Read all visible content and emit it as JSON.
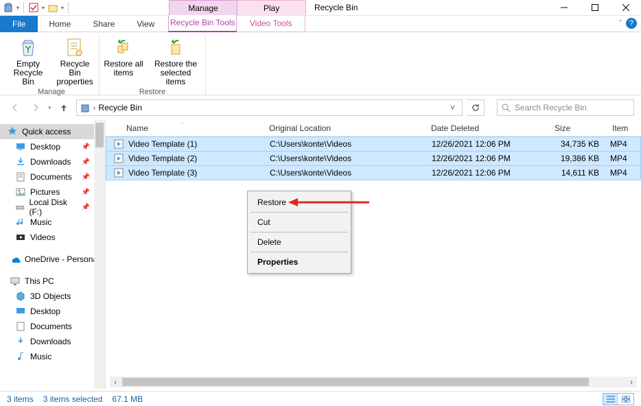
{
  "window": {
    "title": "Recycle Bin"
  },
  "context_tabs": {
    "manage": "Manage",
    "play": "Play"
  },
  "ribbon_tabs": {
    "file": "File",
    "home": "Home",
    "share": "Share",
    "view": "View",
    "rbtools": "Recycle Bin Tools",
    "vtools": "Video Tools"
  },
  "ribbon": {
    "empty": "Empty Recycle Bin",
    "props": "Recycle Bin properties",
    "restore_all": "Restore all items",
    "restore_sel": "Restore the selected items",
    "grp_manage": "Manage",
    "grp_restore": "Restore"
  },
  "breadcrumb": {
    "location": "Recycle Bin"
  },
  "search": {
    "placeholder": "Search Recycle Bin"
  },
  "nav": {
    "quick_access": "Quick access",
    "desktop": "Desktop",
    "downloads": "Downloads",
    "documents": "Documents",
    "pictures": "Pictures",
    "localdisk": "Local Disk (F:)",
    "music": "Music",
    "videos": "Videos",
    "onedrive": "OneDrive - Personal",
    "thispc": "This PC",
    "pc_3d": "3D Objects",
    "pc_desktop": "Desktop",
    "pc_documents": "Documents",
    "pc_downloads": "Downloads",
    "pc_music": "Music"
  },
  "columns": {
    "name": "Name",
    "loc": "Original Location",
    "date": "Date Deleted",
    "size": "Size",
    "type": "Item"
  },
  "files": [
    {
      "name": "Video Template (1)",
      "loc": "C:\\Users\\konte\\Videos",
      "date": "12/26/2021 12:06 PM",
      "size": "34,735 KB",
      "type": "MP4"
    },
    {
      "name": "Video Template (2)",
      "loc": "C:\\Users\\konte\\Videos",
      "date": "12/26/2021 12:06 PM",
      "size": "19,386 KB",
      "type": "MP4"
    },
    {
      "name": "Video Template (3)",
      "loc": "C:\\Users\\konte\\Videos",
      "date": "12/26/2021 12:06 PM",
      "size": "14,611 KB",
      "type": "MP4"
    }
  ],
  "ctxmenu": {
    "restore": "Restore",
    "cut": "Cut",
    "delete": "Delete",
    "properties": "Properties"
  },
  "status": {
    "count": "3 items",
    "selected": "3 items selected",
    "size": "67.1 MB"
  }
}
